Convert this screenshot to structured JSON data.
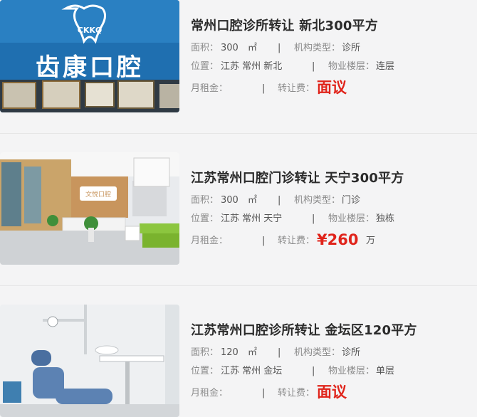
{
  "listings": [
    {
      "title": "常州口腔诊所转让 新北300平方",
      "area_label": "面积：",
      "area_value": "300",
      "area_unit": "㎡",
      "type_label": "机构类型：",
      "type_value": "诊所",
      "location_label": "位置：",
      "location_value": "江苏 常州 新北",
      "floor_label": "物业楼层：",
      "floor_value": "连层",
      "rent_label": "月租金：",
      "transfer_label": "转让费：",
      "transfer_value": "面议",
      "transfer_unit": "",
      "image_sign_text": "齿康口腔",
      "image_logo_text": "CKKQ"
    },
    {
      "title": "江苏常州口腔门诊转让 天宁300平方",
      "area_label": "面积：",
      "area_value": "300",
      "area_unit": "㎡",
      "type_label": "机构类型：",
      "type_value": "门诊",
      "location_label": "位置：",
      "location_value": "江苏 常州 天宁",
      "floor_label": "物业楼层：",
      "floor_value": "独栋",
      "rent_label": "月租金：",
      "transfer_label": "转让费：",
      "transfer_value": "¥260",
      "transfer_unit": "万",
      "image_sign_text": "文悦口腔"
    },
    {
      "title": "江苏常州口腔诊所转让 金坛区120平方",
      "area_label": "面积：",
      "area_value": "120",
      "area_unit": "㎡",
      "type_label": "机构类型：",
      "type_value": "诊所",
      "location_label": "位置：",
      "location_value": "江苏 常州 金坛",
      "floor_label": "物业楼层：",
      "floor_value": "单层",
      "rent_label": "月租金：",
      "transfer_label": "转让费：",
      "transfer_value": "面议",
      "transfer_unit": ""
    }
  ],
  "separator": "|",
  "colors": {
    "price": "#e0241b",
    "title": "#2b2b2b",
    "label": "#8a8a8a",
    "background": "#f4f4f5"
  }
}
